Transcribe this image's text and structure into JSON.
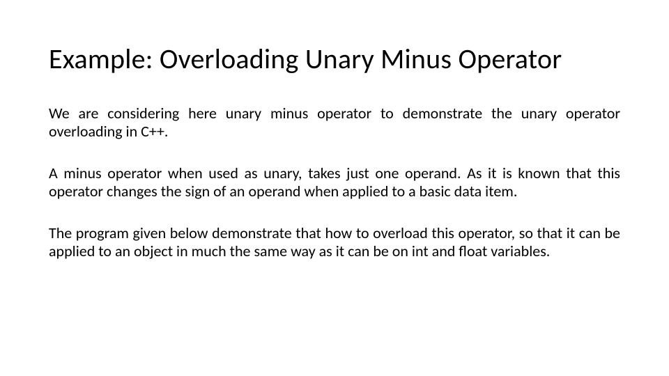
{
  "title": "Example: Overloading Unary Minus Operator",
  "paragraphs": [
    "We are considering here unary minus operator to demonstrate the unary operator overloading in C++.",
    "A minus operator when used as unary, takes just one operand. As it is known that this operator changes the sign of an operand when applied to a basic data item.",
    "The program given below demonstrate that how to overload this operator, so that it can be applied to an object in much the same way as it can be on int and float variables."
  ]
}
